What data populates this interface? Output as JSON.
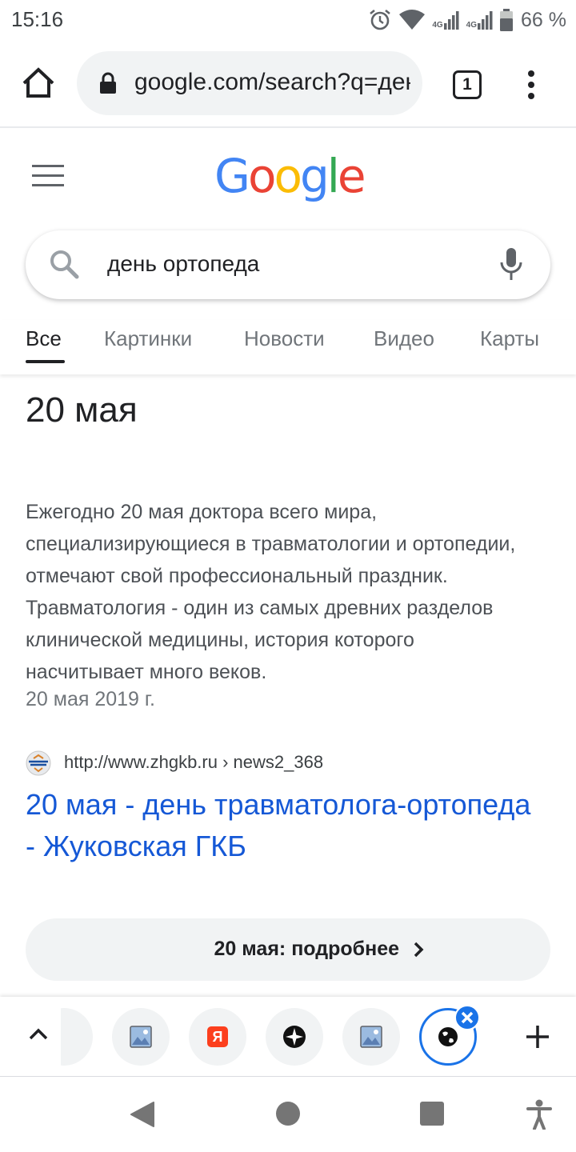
{
  "status_bar": {
    "time": "15:16",
    "net1": "4G",
    "net2": "4G",
    "battery": "66 %"
  },
  "browser": {
    "url": "google.com/search?q=день",
    "tab_count": "1"
  },
  "google": {
    "logo_letters": [
      "G",
      "o",
      "o",
      "g",
      "l",
      "e"
    ],
    "query": "день ортопеда",
    "tabs": [
      "Все",
      "Картинки",
      "Новости",
      "Видео",
      "Карты"
    ],
    "active_tab": "Все"
  },
  "snippet": {
    "answer": "20 мая",
    "text": "Ежегодно 20 мая доктора всего мира, специализирующиеся в травматологии и ортопедии, отмечают свой профессиональный праздник. Травматология - один из самых древних разделов клинической медицины, история которого насчитывает много веков.",
    "date": "20 мая 2019 г.",
    "source_url": "http://www.zhgkb.ru › news2_368",
    "source_title": "20 мая - день травматолога-ортопеда - Жуковская ГКБ",
    "more_label": "20 мая: подробнее"
  },
  "tab_strip": {
    "yandex_letter": "Я"
  },
  "colors": {
    "link": "#1558d6",
    "accent": "#1a73e8",
    "google_blue": "#4285f4",
    "google_red": "#ea4335",
    "google_yellow": "#fbbc05",
    "google_green": "#34a853"
  }
}
